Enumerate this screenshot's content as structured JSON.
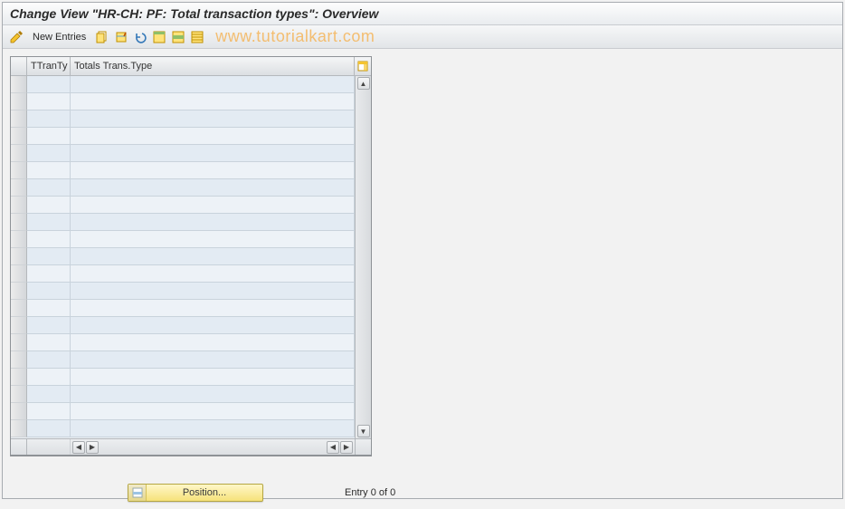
{
  "header": {
    "title": "Change View \"HR-CH: PF: Total transaction types\": Overview"
  },
  "toolbar": {
    "new_entries_label": "New Entries"
  },
  "watermark": "www.tutorialkart.com",
  "grid": {
    "columns": {
      "ttranty": "TTranTy",
      "totals_trans_type": "Totals Trans.Type"
    },
    "row_count": 21
  },
  "footer": {
    "position_label": "Position...",
    "entry_status": "Entry 0 of 0"
  }
}
